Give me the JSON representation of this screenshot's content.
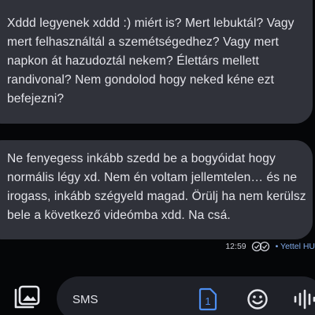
{
  "conversation": {
    "messages": [
      {
        "text": "Xddd legyenek xddd :) miért is? Mert lebuktál? Vagy mert felhasználtál a szemétségedhez? Vagy mert napkon át hazudoztál nekem? Élettárs mellett randivonal? Nem gondolod hogy neked kéne ezt befejezni?"
      },
      {
        "text": "Ne fenyegess inkább szedd be a bogyóidat hogy normális légy xd. Nem én voltam jellemtelen… és ne irogass, inkább szégyeld magad. Örülj ha nem kerülsz bele a következő videómba xdd. Na csá.",
        "time": "12:59",
        "carrier": "Yettel HU"
      }
    ]
  },
  "composer": {
    "placeholder": "SMS",
    "sim_number": "1",
    "icons": {
      "attach": "gallery-attach-icon",
      "sim": "sim-card-icon",
      "emoji": "emoji-icon",
      "voice": "voice-wave-icon"
    }
  },
  "colors": {
    "background": "#050608",
    "bubble": "#30323a",
    "accent": "#7fa8e6",
    "sim_blue": "#4d8ef0"
  }
}
